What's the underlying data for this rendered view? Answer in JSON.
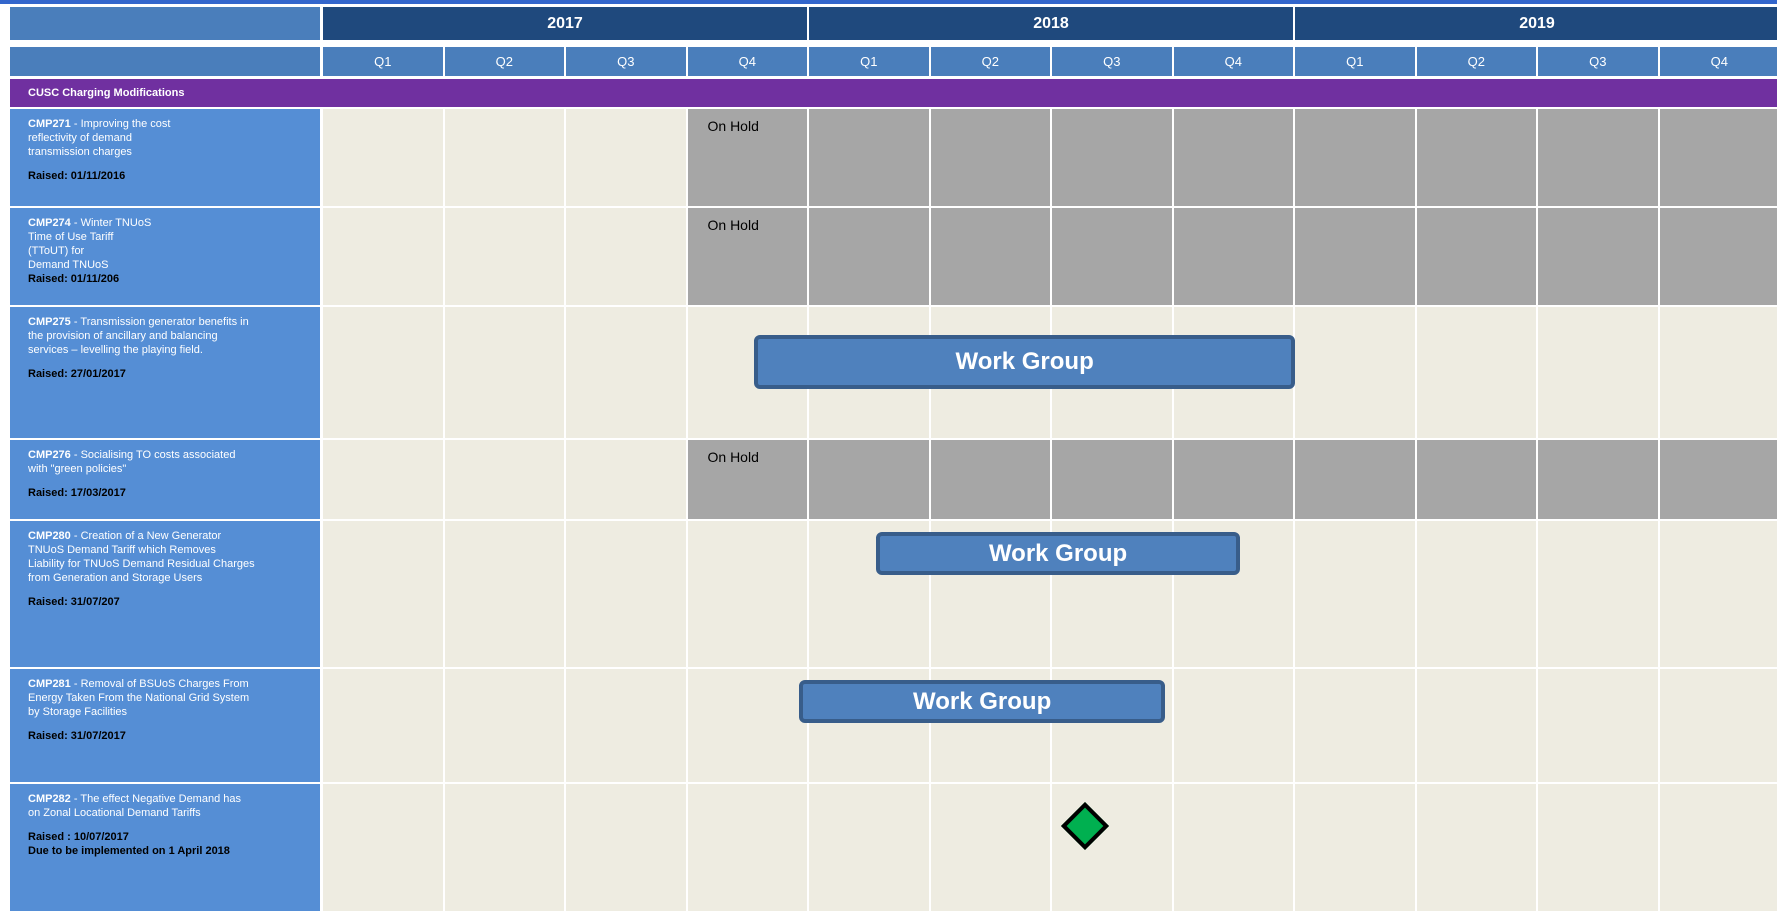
{
  "colors": {
    "year_header": "#1f497d",
    "quarter_header": "#4a7ebb",
    "section_header": "#7030a0",
    "label_cell": "#558ed5",
    "grid_cell": "#eeece1",
    "on_hold": "#a6a6a6",
    "work_group": "#4f81bd",
    "milestone": "#00b050",
    "title_strip": "#3366cc"
  },
  "timeline": {
    "years": [
      "2017",
      "2018",
      "2019"
    ],
    "quarters": [
      "Q1",
      "Q2",
      "Q3",
      "Q4",
      "Q1",
      "Q2",
      "Q3",
      "Q4",
      "Q1",
      "Q2",
      "Q3",
      "Q4"
    ]
  },
  "section": {
    "title": "CUSC  Charging Modifications"
  },
  "rows": [
    {
      "code": "CMP271",
      "desc_lines": [
        "- Improving  the cost",
        "reflectivity of demand",
        "transmission  charges"
      ],
      "raised": "Raised:  01/11/2016",
      "extra": "",
      "on_hold": {
        "label": "On Hold",
        "from_quarter": 4
      },
      "work_group": null,
      "milestone": null
    },
    {
      "code": "CMP274",
      "desc_lines": [
        "- Winter TNUoS",
        "Time of Use Tariff",
        "(TToUT) for",
        "Demand  TNUoS"
      ],
      "raised": "Raised:  01/11/206",
      "extra": "",
      "on_hold": {
        "label": "On Hold",
        "from_quarter": 4
      },
      "work_group": null,
      "milestone": null
    },
    {
      "code": "CMP275",
      "desc_lines": [
        "- Transmission  generator  benefits  in",
        "the provision  of ancillary  and balancing",
        "services  – levelling  the playing  field."
      ],
      "raised": "Raised:  27/01/2017",
      "extra": "",
      "on_hold": null,
      "work_group": {
        "label": "Work Group",
        "start_quarter": 3.55,
        "end_quarter": 8.0
      },
      "milestone": null
    },
    {
      "code": "CMP276",
      "desc_lines": [
        "- Socialising   TO costs associated",
        "with \"green policies\""
      ],
      "raised": "Raised:  17/03/2017",
      "extra": "",
      "on_hold": {
        "label": "On Hold",
        "from_quarter": 4
      },
      "work_group": null,
      "milestone": null
    },
    {
      "code": "CMP280",
      "desc_lines": [
        "- Creation  of a New Generator",
        "TNUoS Demand  Tariff which  Removes",
        "Liability  for TNUoS  Demand Residual  Charges",
        "from Generation  and  Storage Users"
      ],
      "raised": "Raised:  31/07/207",
      "extra": "",
      "on_hold": null,
      "work_group": {
        "label": "Work Group",
        "start_quarter": 4.55,
        "end_quarter": 7.55
      },
      "milestone": null
    },
    {
      "code": "CMP281",
      "desc_lines": [
        "- Removal  of BSUoS Charges  From",
        "Energy Taken  From the National  Grid System",
        "by Storage  Facilities"
      ],
      "raised": "Raised:  31/07/2017",
      "extra": "",
      "on_hold": null,
      "work_group": {
        "label": "Work Group",
        "start_quarter": 3.92,
        "end_quarter": 6.93
      },
      "milestone": null
    },
    {
      "code": "CMP282",
      "desc_lines": [
        "- The effect  Negative  Demand  has",
        "on Zonal Locational  Demand  Tariffs"
      ],
      "raised": "Raised  : 10/07/2017",
      "extra": "Due to be implemented  on 1 April 2018",
      "on_hold": null,
      "work_group": null,
      "milestone": {
        "quarter_position": 6.27,
        "shape": "green-diamond"
      }
    }
  ]
}
